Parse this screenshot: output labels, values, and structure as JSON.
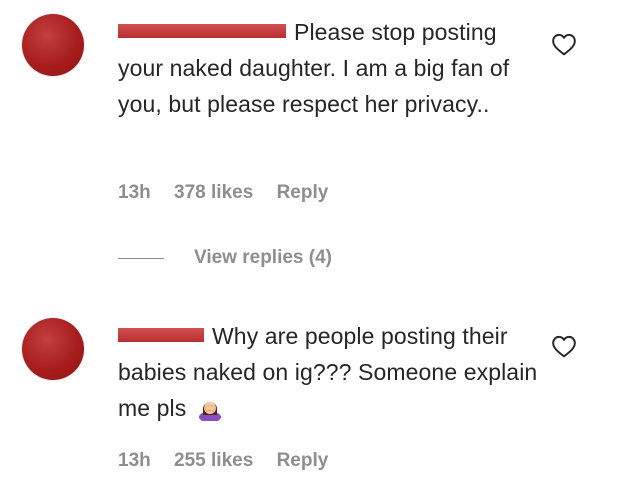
{
  "comments": [
    {
      "text_line1": "Please stop posting",
      "text_rest": "your naked daughter. I am a big fan of you, but please respect her privacy..",
      "time": "13h",
      "likes": "378 likes",
      "reply_label": "Reply",
      "view_replies": "View replies (4)"
    },
    {
      "text_line1": "Why are people posting",
      "text_rest": "their babies naked on ig??? Someone explain me pls",
      "emoji": "woman-facepalming-icon",
      "time": "13h",
      "likes": "255 likes",
      "reply_label": "Reply"
    }
  ],
  "colors": {
    "text": "#262626",
    "muted": "#8e8e8e",
    "avatar": "#a81d1d",
    "redaction": "#c03a3a"
  }
}
